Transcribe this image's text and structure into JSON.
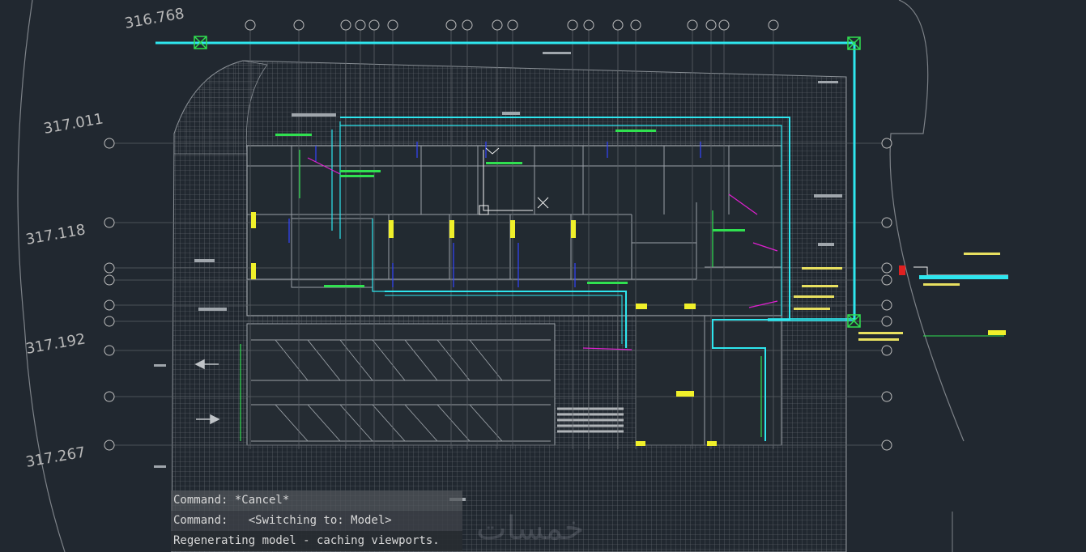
{
  "elevation_labels": [
    "316.768",
    "317.011",
    "317.118",
    "317.192",
    "317.267"
  ],
  "command_lines": [
    "Command: *Cancel*",
    "Command:   <Switching to: Model>",
    "Regenerating model - caching viewports."
  ],
  "watermark_text": "خمسات",
  "colors": {
    "background": "#212830",
    "pipe_main": "#2ee6ee",
    "walls": "#9aa0a6",
    "hatch": "#6b7076",
    "grid_bubble": "#bdbdbd",
    "annotation_yellow": "#f0f02a",
    "annotation_magenta": "#e020d0",
    "annotation_green": "#30e050",
    "annotation_blue": "#3344ff"
  }
}
